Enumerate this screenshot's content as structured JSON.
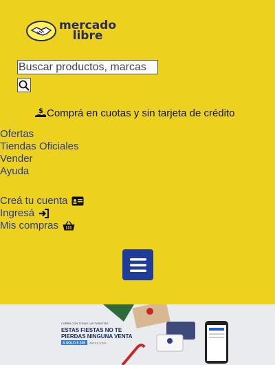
{
  "header": {
    "logo_line1": "mercado",
    "logo_line2": "libre"
  },
  "search": {
    "placeholder": "Buscar productos, marcas"
  },
  "promo": {
    "text": "Comprá en cuotas y sin tarjeta de crédito"
  },
  "nav": {
    "items": [
      "Ofertas",
      "Tiendas Oficiales",
      "Vender",
      "Ayuda"
    ]
  },
  "account": {
    "create": "Creá tu cuenta",
    "login": "Ingresá",
    "purchases": "Mis compras"
  },
  "banner": {
    "small": "COBRÁ CON TODAS LAS TARJETAS",
    "line1": "ESTAS FIESTAS NO TE",
    "line2": "PIERDAS NINGUNA VENTA",
    "price": "A SOLO $ 249",
    "old_price": "ANTES $ 599"
  },
  "colors": {
    "brand_yellow": "#ecd21f",
    "brand_blue": "#1f3c9a"
  }
}
